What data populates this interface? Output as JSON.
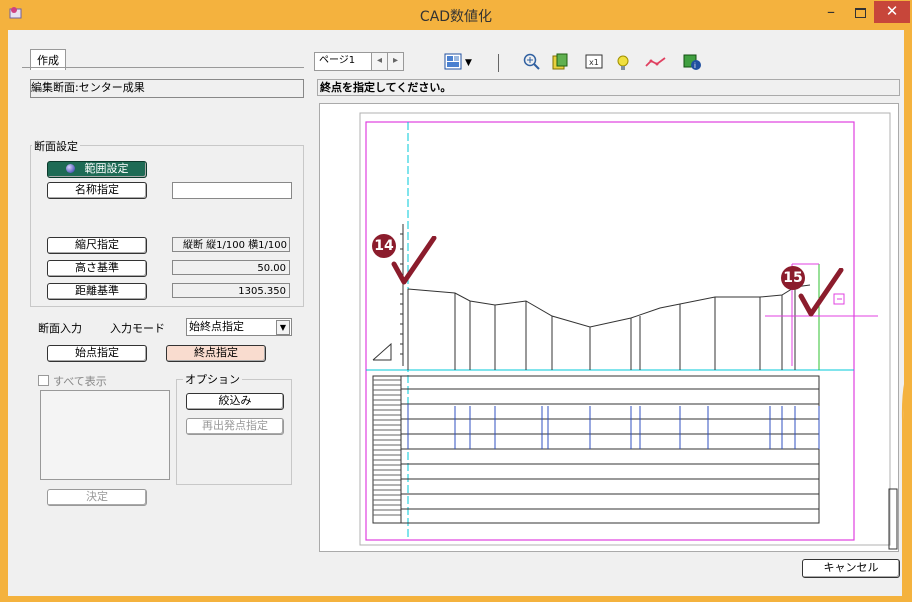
{
  "window": {
    "title": "CAD数値化",
    "min_glyph": "–",
    "close_glyph": "✕"
  },
  "left": {
    "tab_label": "作成",
    "edit_section": "編集断面:センター成果",
    "section_group_label": "断面設定",
    "range_button": "範囲設定",
    "name_button": "名称指定",
    "name_value": "",
    "scale_button": "縮尺指定",
    "scale_value": "縦断 縦1/100 横1/100",
    "height_button": "高さ基準",
    "height_value": "50.00",
    "distance_button": "距離基準",
    "distance_value": "1305.350",
    "section_input_label": "断面入力",
    "input_mode_label": "入力モード",
    "input_mode_value": "始終点指定",
    "start_button": "始点指定",
    "end_button": "終点指定",
    "show_all_label": "すべて表示",
    "options_label": "オプション",
    "narrow_button": "絞込み",
    "restart_button": "再出発点指定",
    "confirm_button": "決定"
  },
  "right": {
    "page_label": "ページ1",
    "prev_glyph": "◂",
    "next_glyph": "▸",
    "instruction": "終点を指定してください。",
    "cancel_button": "キャンセル"
  },
  "markers": {
    "m14": "14",
    "m15": "15"
  },
  "colors": {
    "titlebar": "#f4b23e",
    "close": "#c7463a",
    "marker": "#8b1c2c",
    "magenta": "#e040e0",
    "cyan": "#00c8d8",
    "green": "#30c030",
    "dark_button": "#1e6b55"
  }
}
